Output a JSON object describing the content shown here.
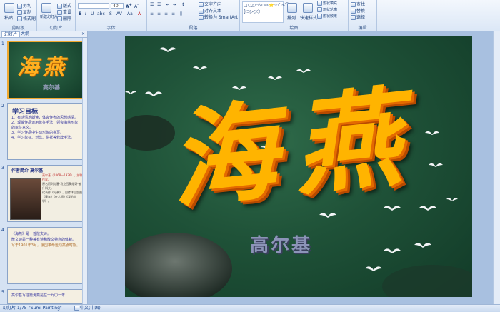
{
  "ribbon": {
    "clipboard": {
      "paste": "粘贴",
      "cut": "剪切",
      "copy": "复制",
      "format_painter": "格式刷",
      "group": "剪贴板"
    },
    "slides": {
      "new_slide": "新建幻灯片",
      "layout": "版式",
      "reset": "重设",
      "delete": "删除",
      "group": "幻灯片"
    },
    "font": {
      "size_value": "40",
      "group": "字体"
    },
    "paragraph": {
      "text_direction": "文字方向",
      "align_text": "对齐文本",
      "smartart": "转换为 SmartArt",
      "group": "段落"
    },
    "drawing": {
      "arrange": "排列",
      "quick_styles": "快速样式",
      "shape_fill": "形状填充",
      "shape_outline": "形状轮廓",
      "shape_effects": "形状效果",
      "group": "绘图"
    },
    "editing": {
      "find": "查找",
      "replace": "替换",
      "select": "选择",
      "group": "编辑"
    }
  },
  "panel": {
    "tabs": [
      "幻灯片",
      "大纲"
    ],
    "close": "×",
    "slides": [
      {
        "num": "1",
        "title": "海燕",
        "subtitle": "高尔基"
      },
      {
        "num": "2",
        "heading": "学习目标",
        "lines": [
          "1、有感情地朗读，体会作者的思想感情。",
          "2、理解作品运用象征手法，领会海燕形象的象征意义。",
          "3、学习作品中生动形象的描写。",
          "4、学习象征、对比、烘托等修辞手法。"
        ]
      },
      {
        "num": "3",
        "heading": "作者简介 高尔基",
        "lines": [
          "高尔基（1868—1936），苏联作家。",
          "原名阿列克塞·马克西莫维奇·彼什科夫。",
          "代表作《母亲》、自传体三部曲《童年》《在人间》《我的大学》。"
        ]
      },
      {
        "num": "4",
        "lines": [
          "《海燕》是一首散文诗。",
          "散文诗是一种兼有诗和散文特点的体裁。",
          "写于1901年3月，俄国革命运动高涨时期。"
        ]
      },
      {
        "num": "5",
        "lines": [
          "高尔基写这篇海燕是在一九〇一年"
        ]
      }
    ]
  },
  "slide": {
    "title": "海燕",
    "subtitle": "高尔基"
  },
  "status": {
    "slide_of": "幻灯片 1/75",
    "theme": "\"Sumi Painting\"",
    "language": "中文(中国)"
  }
}
